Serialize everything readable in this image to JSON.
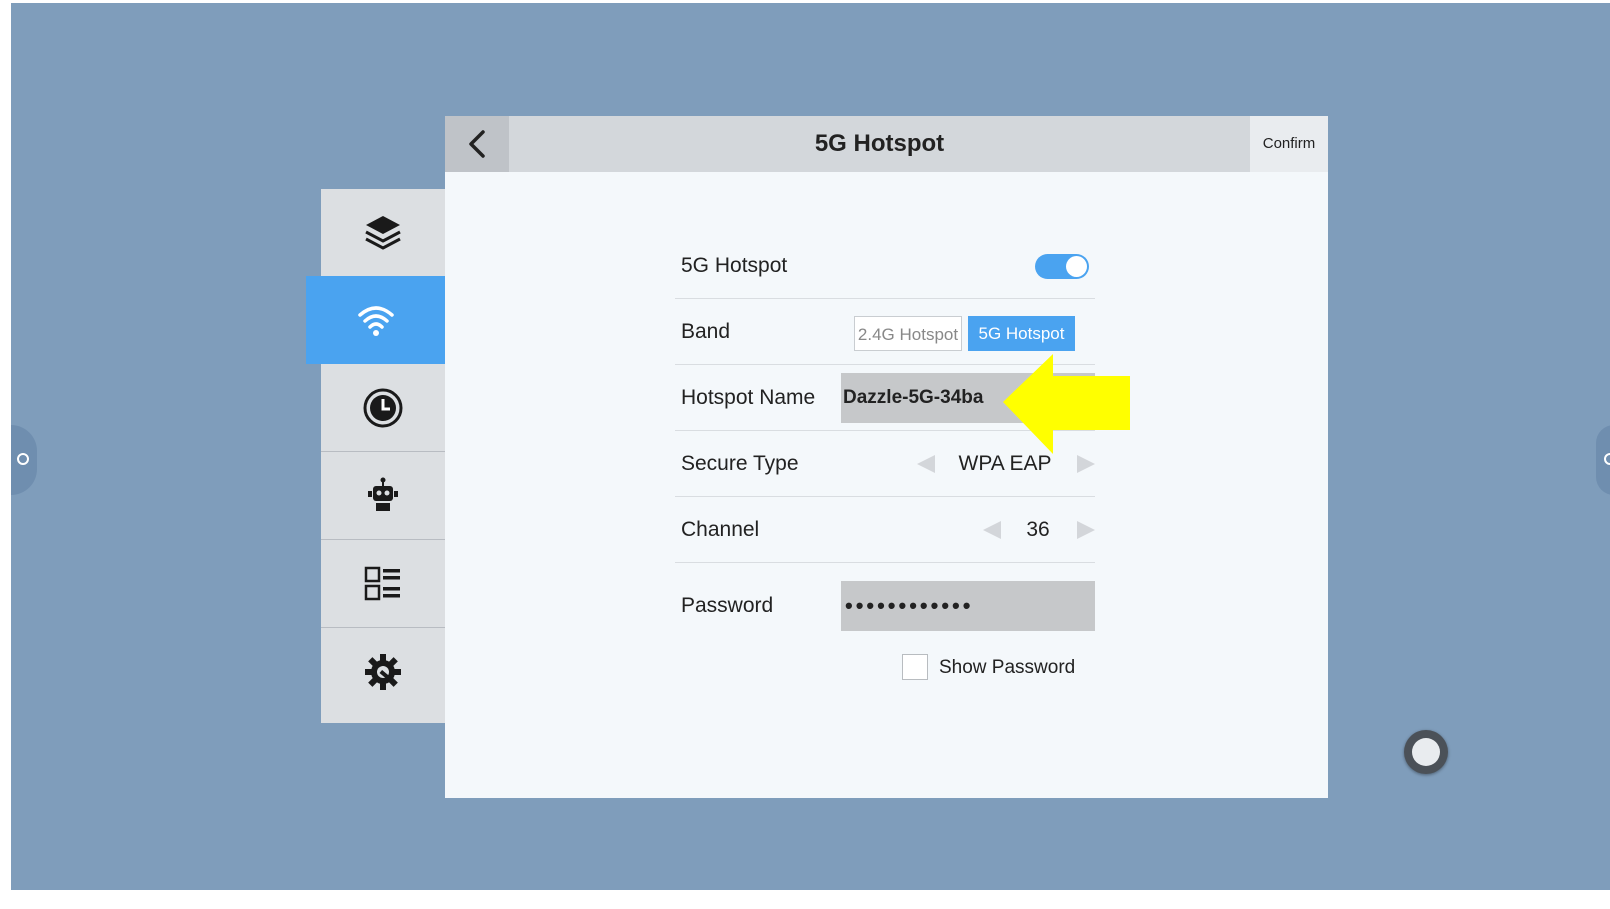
{
  "header": {
    "title": "5G Hotspot",
    "confirm_label": "Confirm"
  },
  "sidebar": {
    "items": [
      {
        "icon": "layers-icon",
        "active": false
      },
      {
        "icon": "wifi-icon",
        "active": true
      },
      {
        "icon": "clock-icon",
        "active": false
      },
      {
        "icon": "robot-icon",
        "active": false
      },
      {
        "icon": "list-icon",
        "active": false
      },
      {
        "icon": "gear-wrench-icon",
        "active": false
      }
    ]
  },
  "settings": {
    "hotspot": {
      "label": "5G Hotspot",
      "enabled": true
    },
    "band": {
      "label": "Band",
      "options": [
        "2.4G Hotspot",
        "5G Hotspot"
      ],
      "selected": "5G Hotspot"
    },
    "name": {
      "label": "Hotspot Name",
      "value": "Dazzle-5G-34ba"
    },
    "secure_type": {
      "label": "Secure Type",
      "value": "WPA EAP"
    },
    "channel": {
      "label": "Channel",
      "value": "36"
    },
    "password": {
      "label": "Password",
      "value": "••••••••••••"
    },
    "show_password": {
      "label": "Show Password",
      "checked": false
    }
  },
  "colors": {
    "background": "#7f9dbb",
    "accent": "#4aa3f0",
    "annotation_arrow": "#ffff00"
  }
}
